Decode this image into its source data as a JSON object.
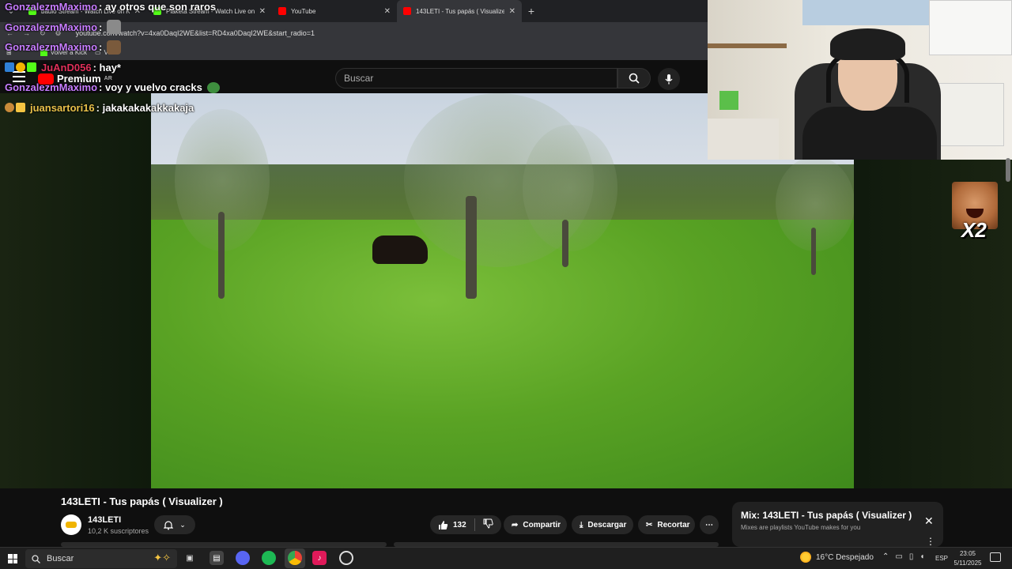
{
  "browser": {
    "tabs": [
      {
        "label": "baulo Stream - Watch Live on Kick",
        "favicon_color": "#53fc18",
        "active": false
      },
      {
        "label": "Plaketa Stream - Watch Live on Kick",
        "favicon_color": "#53fc18",
        "active": false
      },
      {
        "label": "YouTube",
        "favicon_color": "#ff0000",
        "active": false
      },
      {
        "label": "143LETI - Tus papás ( Visualizer )",
        "favicon_color": "#ff0000",
        "active": true
      }
    ],
    "url": "youtube.com/watch?v=4xa0DaqI2WE&list=RD4xa0DaqI2WE&start_radio=1",
    "bookmarks": [
      {
        "label": "Volver a Kick"
      },
      {
        "label": "VIA"
      }
    ]
  },
  "youtube": {
    "logo_text": "Premium",
    "logo_region": "AR",
    "search_placeholder": "Buscar",
    "video_title": "143LETI - Tus papás ( Visualizer )",
    "channel": {
      "name": "143LETI",
      "subscribers": "10,2 K suscriptores"
    },
    "actions": {
      "like_count": "132",
      "share_label": "Compartir",
      "download_label": "Descargar",
      "clip_label": "Recortar"
    },
    "mix_card": {
      "title": "Mix: 143LETI - Tus papás ( Visualizer )",
      "subtitle": "Mixes are playlists YouTube makes for you"
    }
  },
  "stream_overlay": {
    "chat": [
      {
        "user": "GonzalezmMaximo",
        "message": ": ay otros que son raros",
        "color": "purple"
      },
      {
        "user": "GonzalezmMaximo",
        "message": ":",
        "color": "purple",
        "emote": true
      },
      {
        "user": "GonzalezmMaximo",
        "message": ":",
        "color": "purple",
        "emote": true
      },
      {
        "user": "JuAnD056",
        "message": ": hay*",
        "color": "red"
      },
      {
        "user": "GonzalezmMaximo",
        "message": ": voy y vuelvo cracks",
        "color": "purple",
        "emote": true
      },
      {
        "user": "juansartori16",
        "message": ": jakakakakakkakaja",
        "color": "gold"
      }
    ],
    "emote_multiplier": "X2"
  },
  "taskbar": {
    "search_placeholder": "Buscar",
    "weather": "16°C  Despejado",
    "language": "ESP",
    "time": "23:05",
    "date": "5/11/2025"
  }
}
